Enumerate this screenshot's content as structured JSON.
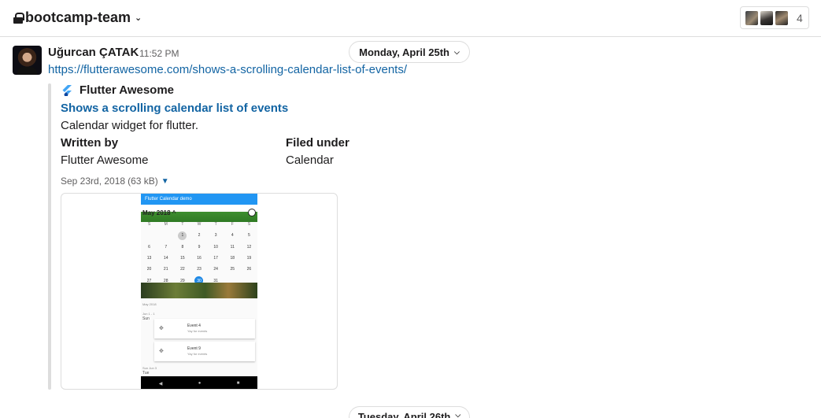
{
  "channel": {
    "name": "bootcamp-team",
    "member_count": "4"
  },
  "message": {
    "author": "Uğurcan ÇATAK",
    "time": "11:52 PM",
    "link": "https://flutterawesome.com/shows-a-scrolling-calendar-list-of-events/"
  },
  "date_divider": "Monday, April 25th",
  "next_date_divider": "Tuesday, April 26th",
  "attachment": {
    "service": "Flutter Awesome",
    "title": "Shows a scrolling calendar list of events",
    "description": "Calendar widget for flutter.",
    "fields": [
      {
        "title": "Written by",
        "value": "Flutter Awesome"
      },
      {
        "title": "Filed under",
        "value": "Calendar"
      }
    ],
    "date": "Sep 23rd, 2018",
    "size": "(63 kB)"
  },
  "preview": {
    "app_title": "Flutter Calendar demo",
    "month": "May 2018 ^",
    "weekdays": [
      "S",
      "M",
      "T",
      "W",
      "T",
      "F",
      "S"
    ],
    "weeks": [
      [
        "",
        "",
        "1",
        "2",
        "3",
        "4",
        "5"
      ],
      [
        "6",
        "7",
        "8",
        "9",
        "10",
        "11",
        "12"
      ],
      [
        "13",
        "14",
        "15",
        "16",
        "17",
        "18",
        "19"
      ],
      [
        "20",
        "21",
        "22",
        "23",
        "24",
        "25",
        "26"
      ],
      [
        "27",
        "28",
        "29",
        "30",
        "31",
        "",
        ""
      ]
    ],
    "list_header": "May 2018",
    "day1_label": "Jun 1 - 1",
    "day1_name": "Sun",
    "events": [
      {
        "title": "Event 4",
        "subtitle": "Yay for events"
      },
      {
        "title": "Event 9",
        "subtitle": "Yay for events"
      }
    ],
    "day2_label": "Sun Jun 3",
    "day2_name": "Tue"
  },
  "colors": {
    "link": "#1264a3",
    "accent": "#1e88e5",
    "appbar": "#2196f3"
  }
}
